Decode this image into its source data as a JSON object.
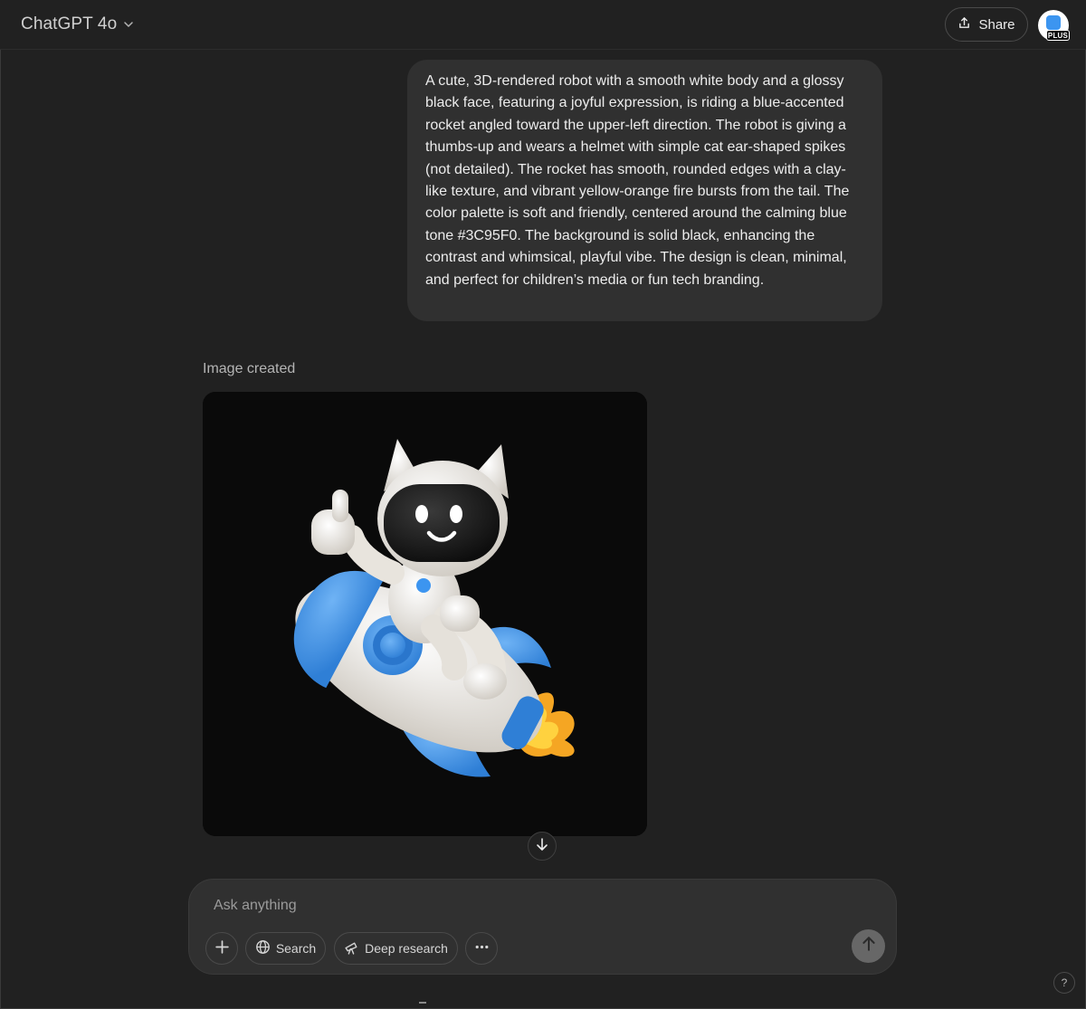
{
  "header": {
    "model_label": "ChatGPT 4o",
    "model_chevron_icon": "chevron-down-icon",
    "share_label": "Share",
    "share_icon": "share-upload-icon",
    "avatar_badge": "PLUS"
  },
  "conversation": {
    "user_message": "A cute, 3D-rendered robot with a smooth white body and a glossy black face, featuring a joyful expression, is riding a blue-accented rocket angled toward the upper-left direction. The robot is giving a thumbs-up and wears a helmet with simple cat ear-shaped spikes (not detailed). The rocket has smooth, rounded edges with a clay-like texture, and vibrant yellow-orange fire bursts from the tail. The color palette is soft and friendly, centered around the calming blue tone #3C95F0. The background is solid black, enhancing the contrast and whimsical, playful vibe. The design is clean, minimal, and perfect for children’s media or fun tech branding.",
    "assistant_status": "Image created",
    "image_colors": {
      "background": "#0a0a0a",
      "accent_blue": "#3C95F0",
      "fire_orange": "#F5A623",
      "fire_yellow": "#FFD23F",
      "robot_white": "#EFEDE8",
      "face_black": "#1a1a1a"
    }
  },
  "composer": {
    "placeholder": "Ask anything",
    "value": "",
    "search_label": "Search",
    "deep_research_label": "Deep research",
    "icons": [
      "plus-icon",
      "globe-icon",
      "telescope-icon",
      "more-dots-icon",
      "send-arrow-icon"
    ]
  },
  "help_label": "?"
}
